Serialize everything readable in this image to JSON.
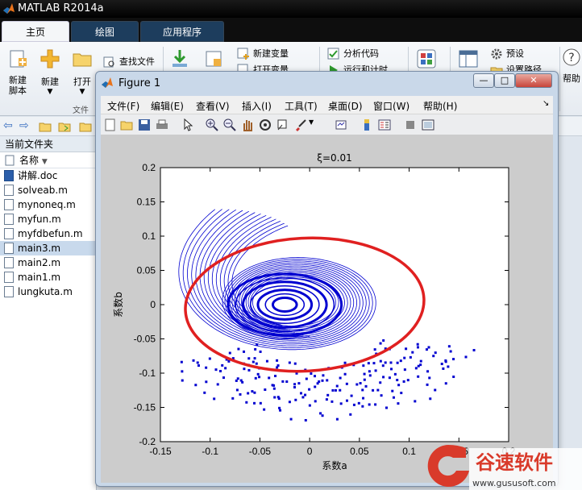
{
  "app": {
    "title": "MATLAB R2014a"
  },
  "ribbon": {
    "tabs": [
      "主页",
      "绘图",
      "应用程序"
    ],
    "new_script": "新建\n脚本",
    "new": "新建",
    "open": "打开",
    "find_files": "查找文件",
    "new_variable": "新建变量",
    "open_variable": "打开变量",
    "analyze_code": "分析代码",
    "run_and_time": "运行和计时",
    "preferences": "预设",
    "set_path": "设置路径",
    "help": "帮助",
    "group_file": "文件"
  },
  "panel": {
    "title": "当前文件夹",
    "col_name": "名称",
    "files": [
      "讲解.doc",
      "solveab.m",
      "mynoneq.m",
      "myfun.m",
      "myfdbefun.m",
      "main3.m",
      "main2.m",
      "main1.m",
      "lungkuta.m"
    ]
  },
  "figure": {
    "title": "Figure 1",
    "menu": [
      "文件(F)",
      "编辑(E)",
      "查看(V)",
      "插入(I)",
      "工具(T)",
      "桌面(D)",
      "窗口(W)",
      "帮助(H)"
    ]
  },
  "chart_data": {
    "type": "line",
    "title": "ξ=0.01",
    "xlabel": "系数a",
    "ylabel": "系数b",
    "xlim": [
      -0.15,
      0.2
    ],
    "ylim": [
      -0.2,
      0.2
    ],
    "xticks": [
      "-0.15",
      "-0.1",
      "-0.05",
      "0",
      "0.05",
      "0.1",
      "0.15",
      "0.2"
    ],
    "yticks": [
      "0.2",
      "0.15",
      "0.1",
      "0.05",
      "0",
      "-0.05",
      "-0.1",
      "-0.15",
      "-0.2"
    ],
    "series_color": "#0000d0",
    "annotation_color": "#e02020"
  },
  "watermark": {
    "brand": "谷速软件",
    "url": "www.gususoft.com"
  }
}
